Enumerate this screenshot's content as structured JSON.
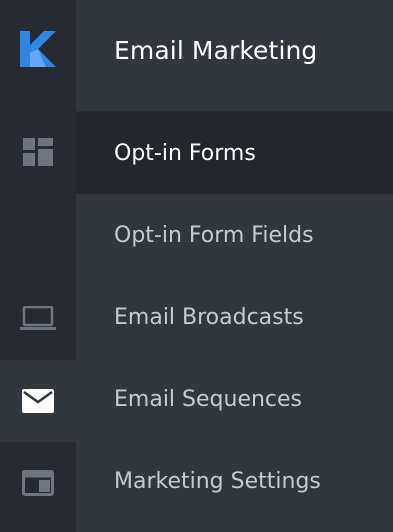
{
  "rail": {
    "logo_icon": "k-logo-icon",
    "items": [
      {
        "icon": "dashboard-icon"
      },
      {
        "icon": "laptop-icon"
      },
      {
        "icon": "envelope-icon",
        "active": true
      },
      {
        "icon": "layout-window-icon"
      }
    ]
  },
  "panel": {
    "title": "Email Marketing",
    "items": [
      {
        "label": "Opt-in Forms",
        "active": true
      },
      {
        "label": "Opt-in Form Fields"
      },
      {
        "label": "Email Broadcasts"
      },
      {
        "label": "Email Sequences"
      },
      {
        "label": "Marketing Settings"
      }
    ]
  },
  "colors": {
    "rail_bg": "#272b31",
    "panel_bg": "#32373d",
    "active_menu_bg": "#23272c",
    "logo_blue": "#2f86e6",
    "text_active": "#ffffff",
    "text_inactive": "#c6cbd3"
  }
}
